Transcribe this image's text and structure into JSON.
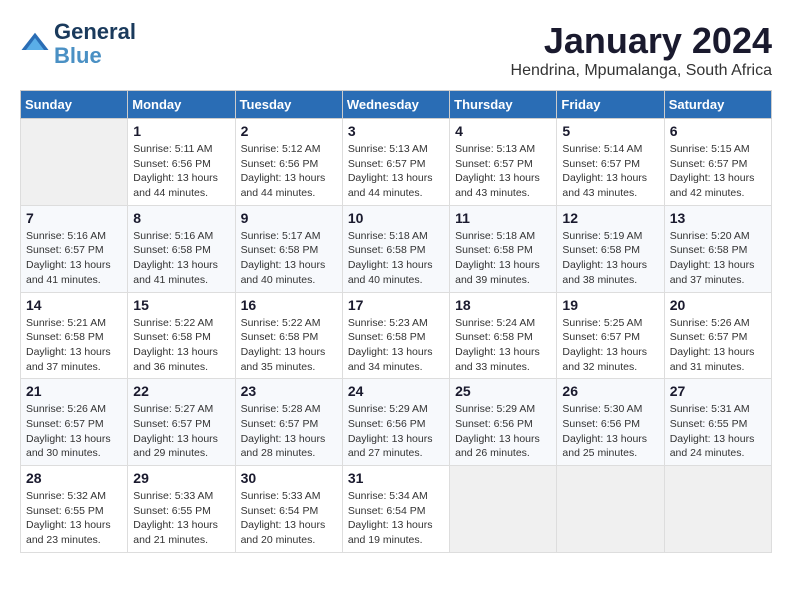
{
  "logo": {
    "line1": "General",
    "line2": "Blue"
  },
  "title": "January 2024",
  "subtitle": "Hendrina, Mpumalanga, South Africa",
  "days_of_week": [
    "Sunday",
    "Monday",
    "Tuesday",
    "Wednesday",
    "Thursday",
    "Friday",
    "Saturday"
  ],
  "weeks": [
    [
      {
        "day": "",
        "info": ""
      },
      {
        "day": "1",
        "info": "Sunrise: 5:11 AM\nSunset: 6:56 PM\nDaylight: 13 hours\nand 44 minutes."
      },
      {
        "day": "2",
        "info": "Sunrise: 5:12 AM\nSunset: 6:56 PM\nDaylight: 13 hours\nand 44 minutes."
      },
      {
        "day": "3",
        "info": "Sunrise: 5:13 AM\nSunset: 6:57 PM\nDaylight: 13 hours\nand 44 minutes."
      },
      {
        "day": "4",
        "info": "Sunrise: 5:13 AM\nSunset: 6:57 PM\nDaylight: 13 hours\nand 43 minutes."
      },
      {
        "day": "5",
        "info": "Sunrise: 5:14 AM\nSunset: 6:57 PM\nDaylight: 13 hours\nand 43 minutes."
      },
      {
        "day": "6",
        "info": "Sunrise: 5:15 AM\nSunset: 6:57 PM\nDaylight: 13 hours\nand 42 minutes."
      }
    ],
    [
      {
        "day": "7",
        "info": "Sunrise: 5:16 AM\nSunset: 6:57 PM\nDaylight: 13 hours\nand 41 minutes."
      },
      {
        "day": "8",
        "info": "Sunrise: 5:16 AM\nSunset: 6:58 PM\nDaylight: 13 hours\nand 41 minutes."
      },
      {
        "day": "9",
        "info": "Sunrise: 5:17 AM\nSunset: 6:58 PM\nDaylight: 13 hours\nand 40 minutes."
      },
      {
        "day": "10",
        "info": "Sunrise: 5:18 AM\nSunset: 6:58 PM\nDaylight: 13 hours\nand 40 minutes."
      },
      {
        "day": "11",
        "info": "Sunrise: 5:18 AM\nSunset: 6:58 PM\nDaylight: 13 hours\nand 39 minutes."
      },
      {
        "day": "12",
        "info": "Sunrise: 5:19 AM\nSunset: 6:58 PM\nDaylight: 13 hours\nand 38 minutes."
      },
      {
        "day": "13",
        "info": "Sunrise: 5:20 AM\nSunset: 6:58 PM\nDaylight: 13 hours\nand 37 minutes."
      }
    ],
    [
      {
        "day": "14",
        "info": "Sunrise: 5:21 AM\nSunset: 6:58 PM\nDaylight: 13 hours\nand 37 minutes."
      },
      {
        "day": "15",
        "info": "Sunrise: 5:22 AM\nSunset: 6:58 PM\nDaylight: 13 hours\nand 36 minutes."
      },
      {
        "day": "16",
        "info": "Sunrise: 5:22 AM\nSunset: 6:58 PM\nDaylight: 13 hours\nand 35 minutes."
      },
      {
        "day": "17",
        "info": "Sunrise: 5:23 AM\nSunset: 6:58 PM\nDaylight: 13 hours\nand 34 minutes."
      },
      {
        "day": "18",
        "info": "Sunrise: 5:24 AM\nSunset: 6:58 PM\nDaylight: 13 hours\nand 33 minutes."
      },
      {
        "day": "19",
        "info": "Sunrise: 5:25 AM\nSunset: 6:57 PM\nDaylight: 13 hours\nand 32 minutes."
      },
      {
        "day": "20",
        "info": "Sunrise: 5:26 AM\nSunset: 6:57 PM\nDaylight: 13 hours\nand 31 minutes."
      }
    ],
    [
      {
        "day": "21",
        "info": "Sunrise: 5:26 AM\nSunset: 6:57 PM\nDaylight: 13 hours\nand 30 minutes."
      },
      {
        "day": "22",
        "info": "Sunrise: 5:27 AM\nSunset: 6:57 PM\nDaylight: 13 hours\nand 29 minutes."
      },
      {
        "day": "23",
        "info": "Sunrise: 5:28 AM\nSunset: 6:57 PM\nDaylight: 13 hours\nand 28 minutes."
      },
      {
        "day": "24",
        "info": "Sunrise: 5:29 AM\nSunset: 6:56 PM\nDaylight: 13 hours\nand 27 minutes."
      },
      {
        "day": "25",
        "info": "Sunrise: 5:29 AM\nSunset: 6:56 PM\nDaylight: 13 hours\nand 26 minutes."
      },
      {
        "day": "26",
        "info": "Sunrise: 5:30 AM\nSunset: 6:56 PM\nDaylight: 13 hours\nand 25 minutes."
      },
      {
        "day": "27",
        "info": "Sunrise: 5:31 AM\nSunset: 6:55 PM\nDaylight: 13 hours\nand 24 minutes."
      }
    ],
    [
      {
        "day": "28",
        "info": "Sunrise: 5:32 AM\nSunset: 6:55 PM\nDaylight: 13 hours\nand 23 minutes."
      },
      {
        "day": "29",
        "info": "Sunrise: 5:33 AM\nSunset: 6:55 PM\nDaylight: 13 hours\nand 21 minutes."
      },
      {
        "day": "30",
        "info": "Sunrise: 5:33 AM\nSunset: 6:54 PM\nDaylight: 13 hours\nand 20 minutes."
      },
      {
        "day": "31",
        "info": "Sunrise: 5:34 AM\nSunset: 6:54 PM\nDaylight: 13 hours\nand 19 minutes."
      },
      {
        "day": "",
        "info": ""
      },
      {
        "day": "",
        "info": ""
      },
      {
        "day": "",
        "info": ""
      }
    ]
  ]
}
